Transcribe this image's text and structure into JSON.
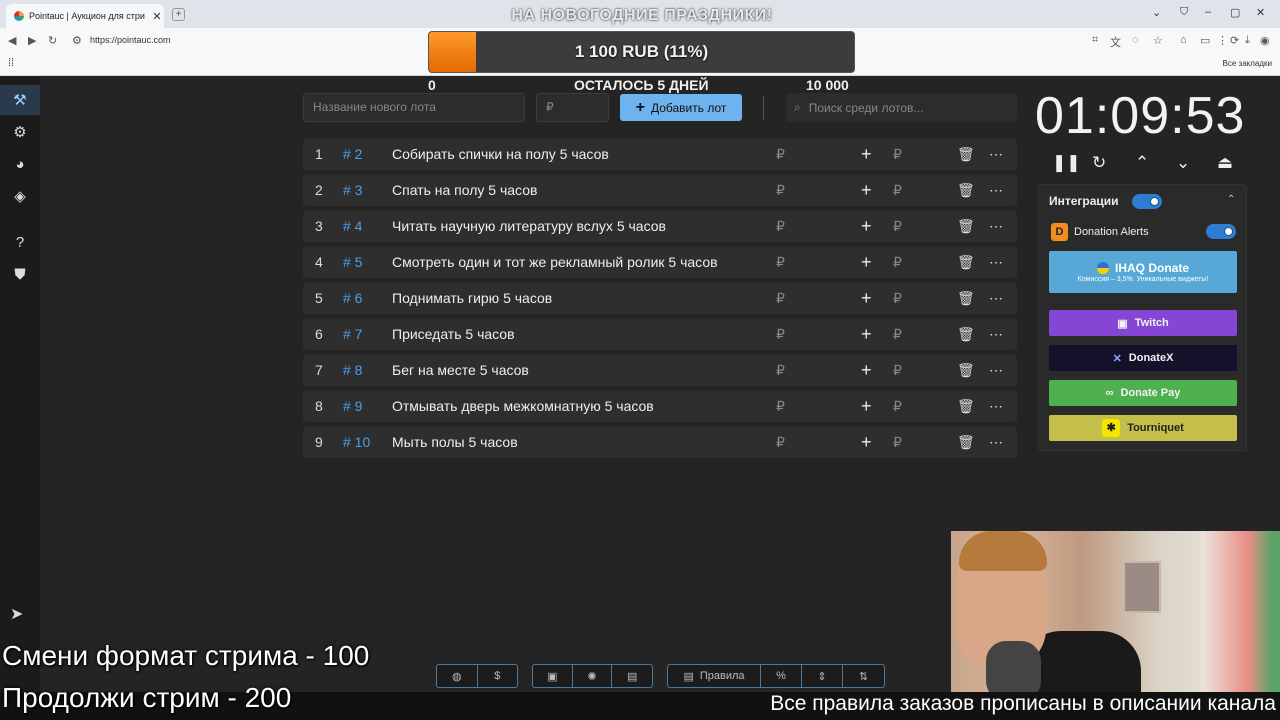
{
  "browser": {
    "tab_title": "Pointauc | Аукцион для стримеров",
    "tab_close": "✕",
    "new_tab": "+",
    "url": "https://pointauc.com",
    "all_bookmarks": "Все закладки"
  },
  "overlay": {
    "banner": "НА НОВОГОДНИЕ ПРАЗДНИКИ!",
    "progress_text": "1 100 RUB (11%)",
    "progress_fraction": 0.11,
    "min_label": "0",
    "remaining_label": "ОСТАЛОСЬ 5 ДНЕЙ",
    "max_label": "10 000",
    "progress_color": "#f07d10"
  },
  "lot_form": {
    "name_placeholder": "Название нового лота",
    "amount_placeholder": "₽",
    "add_button": "Добавить лот",
    "search_placeholder": "Поиск среди лотов..."
  },
  "lots": [
    {
      "num": "1",
      "id": "# 2",
      "name": "Собирать спички на полу 5 часов"
    },
    {
      "num": "2",
      "id": "# 3",
      "name": "Спать на полу 5 часов"
    },
    {
      "num": "3",
      "id": "# 4",
      "name": "Читать научную литературу вслух 5 часов"
    },
    {
      "num": "4",
      "id": "# 5",
      "name": "Смотреть один и тот же рекламный ролик 5 часов"
    },
    {
      "num": "5",
      "id": "# 6",
      "name": "Поднимать гирю 5 часов"
    },
    {
      "num": "6",
      "id": "# 7",
      "name": "Приседать 5 часов"
    },
    {
      "num": "7",
      "id": "# 8",
      "name": "Бег на месте 5 часов"
    },
    {
      "num": "8",
      "id": "# 9",
      "name": "Отмывать дверь межкомнатную 5 часов"
    },
    {
      "num": "9",
      "id": "# 10",
      "name": "Мыть полы 5 часов"
    }
  ],
  "lot_symbols": {
    "rub": "₽",
    "plus": "+",
    "trash": "🗑",
    "more": "⋯"
  },
  "timer": {
    "value": "01:09:53",
    "pause": "❚❚",
    "reset": "↻",
    "up": "⌃",
    "down": "⌄",
    "top": "⏏"
  },
  "integrations": {
    "title": "Интеграции",
    "collapse": "⌃",
    "donation_alerts": "Donation Alerts",
    "ihaq_title": "IHAQ Donate",
    "ihaq_sub": "Комиссия – 3,5%. Уникальные виджеты!",
    "twitch": "Twitch",
    "donatex": "DonateX",
    "donatepay": "Donate Pay",
    "tourniquet": "Tourniquet",
    "colors": {
      "ihaq": "#57a8d6",
      "twitch": "#8546d6",
      "donatex": "#14112a",
      "donatepay": "#4fb04f",
      "tourniquet": "#c3bf4a"
    }
  },
  "toolbar": {
    "rules": "Правила",
    "percent": "%"
  },
  "stream_overlay": {
    "line1": "Смени формат стрима - 100",
    "line2": "Продолжи стрим - 200",
    "bottom_ticker": "Все правила заказов прописаны в описании канала"
  }
}
